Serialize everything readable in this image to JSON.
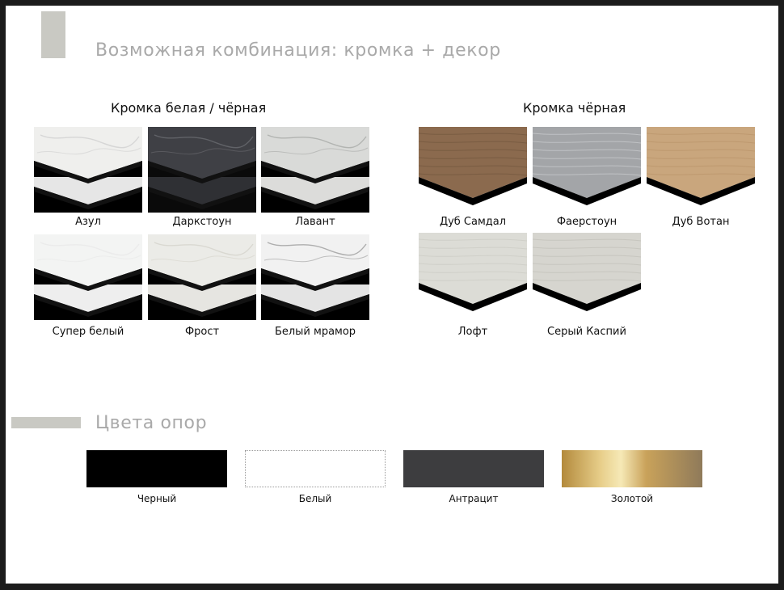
{
  "page": {
    "title": "Возможная комбинация: кромка + декор",
    "supports_title": "Цвета опор"
  },
  "groups": [
    {
      "heading": "Кромка белая / чёрная",
      "decors": [
        {
          "name": "Азул",
          "icon": "azul-marble-swatch-icon",
          "colors": {
            "top": "#efefed",
            "vein": "#cfcfcf",
            "layer": "#e6e6e6",
            "base": "#000000"
          }
        },
        {
          "name": "Даркстоун",
          "icon": "darkstone-swatch-icon",
          "colors": {
            "top": "#3f4045",
            "vein": "#6a6b70",
            "layer": "#2f3034",
            "base": "#0a0a0a"
          }
        },
        {
          "name": "Лавант",
          "icon": "lavant-marble-swatch-icon",
          "colors": {
            "top": "#d9dad8",
            "vein": "#a8aaa8",
            "layer": "#dcdcda",
            "base": "#000000"
          }
        },
        {
          "name": "Супер белый",
          "icon": "super-white-swatch-icon",
          "colors": {
            "top": "#f3f4f3",
            "vein": "#e8e8e8",
            "layer": "#eeeeee",
            "base": "#000000"
          }
        },
        {
          "name": "Фрост",
          "icon": "frost-swatch-icon",
          "colors": {
            "top": "#ebebe7",
            "vein": "#d5d3cc",
            "layer": "#e6e5e1",
            "base": "#000000"
          }
        },
        {
          "name": "Белый мрамор",
          "icon": "white-marble-swatch-icon",
          "colors": {
            "top": "#f1f1f1",
            "vein": "#9c9c9c",
            "layer": "#e4e4e4",
            "base": "#000000"
          }
        }
      ]
    },
    {
      "heading": "Кромка чёрная",
      "decors": [
        {
          "name": "Дуб Самдал",
          "icon": "oak-samdal-swatch-icon",
          "colors": {
            "top": "#8b6a4e",
            "vein": "#6c5038",
            "layer": "#000000",
            "base": "#ffffff"
          }
        },
        {
          "name": "Фаерстоун",
          "icon": "firestone-swatch-icon",
          "colors": {
            "top": "#a3a5a8",
            "vein": "#d9dadc",
            "layer": "#000000",
            "base": "#ffffff"
          }
        },
        {
          "name": "Дуб Вотан",
          "icon": "oak-votan-swatch-icon",
          "colors": {
            "top": "#c9a67d",
            "vein": "#b48e64",
            "layer": "#000000",
            "base": "#ffffff"
          }
        },
        {
          "name": "Лофт",
          "icon": "loft-swatch-icon",
          "colors": {
            "top": "#dcdcd6",
            "vein": "#c6c6bf",
            "layer": "#000000",
            "base": "#ffffff"
          }
        },
        {
          "name": "Серый Каспий",
          "icon": "grey-caspian-swatch-icon",
          "colors": {
            "top": "#d6d5cf",
            "vein": "#bcbab2",
            "layer": "#000000",
            "base": "#ffffff"
          }
        }
      ]
    }
  ],
  "supports": [
    {
      "name": "Черный",
      "color": "#000000"
    },
    {
      "name": "Белый",
      "color": "#ffffff"
    },
    {
      "name": "Антрацит",
      "color": "#3d3d3f"
    },
    {
      "name": "Золотой",
      "color": "#c9a25a"
    }
  ]
}
